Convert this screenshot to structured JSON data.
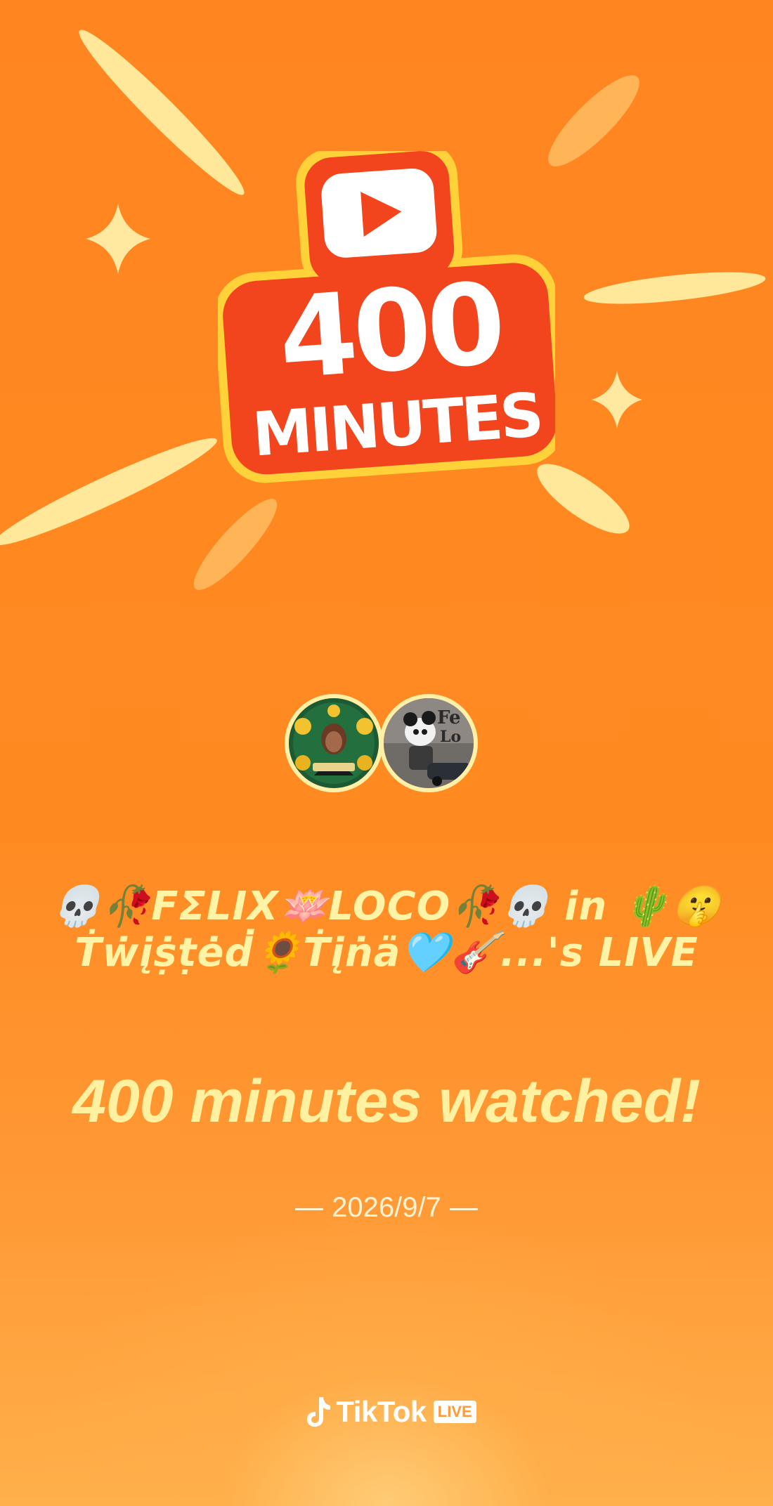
{
  "colors": {
    "background": "#ff8a1f",
    "headline_text": "#fff1a0",
    "badge_red": "#f2441d",
    "badge_border": "#ffd23a",
    "badge_text": "#ffffff"
  },
  "badge": {
    "number": "400",
    "unit": "MINUTES",
    "icon": "play-button-icon"
  },
  "live": {
    "title": "💀🥀FΣLIX🪷LOCO🥀💀 in 🌵🤫Ṫẇįṩṭėḋ🌻Ṫįṅä🩵🎸...'s LIVE"
  },
  "milestone": {
    "headline": "400 minutes watched!",
    "date": "2026/9/7"
  },
  "branding": {
    "name": "TikTok",
    "tag": "LIVE",
    "icon": "tiktok-note-icon"
  },
  "avatars": [
    {
      "name": "host-avatar",
      "icon": "profile-photo-icon"
    },
    {
      "name": "guest-avatar",
      "icon": "profile-photo-icon"
    }
  ]
}
